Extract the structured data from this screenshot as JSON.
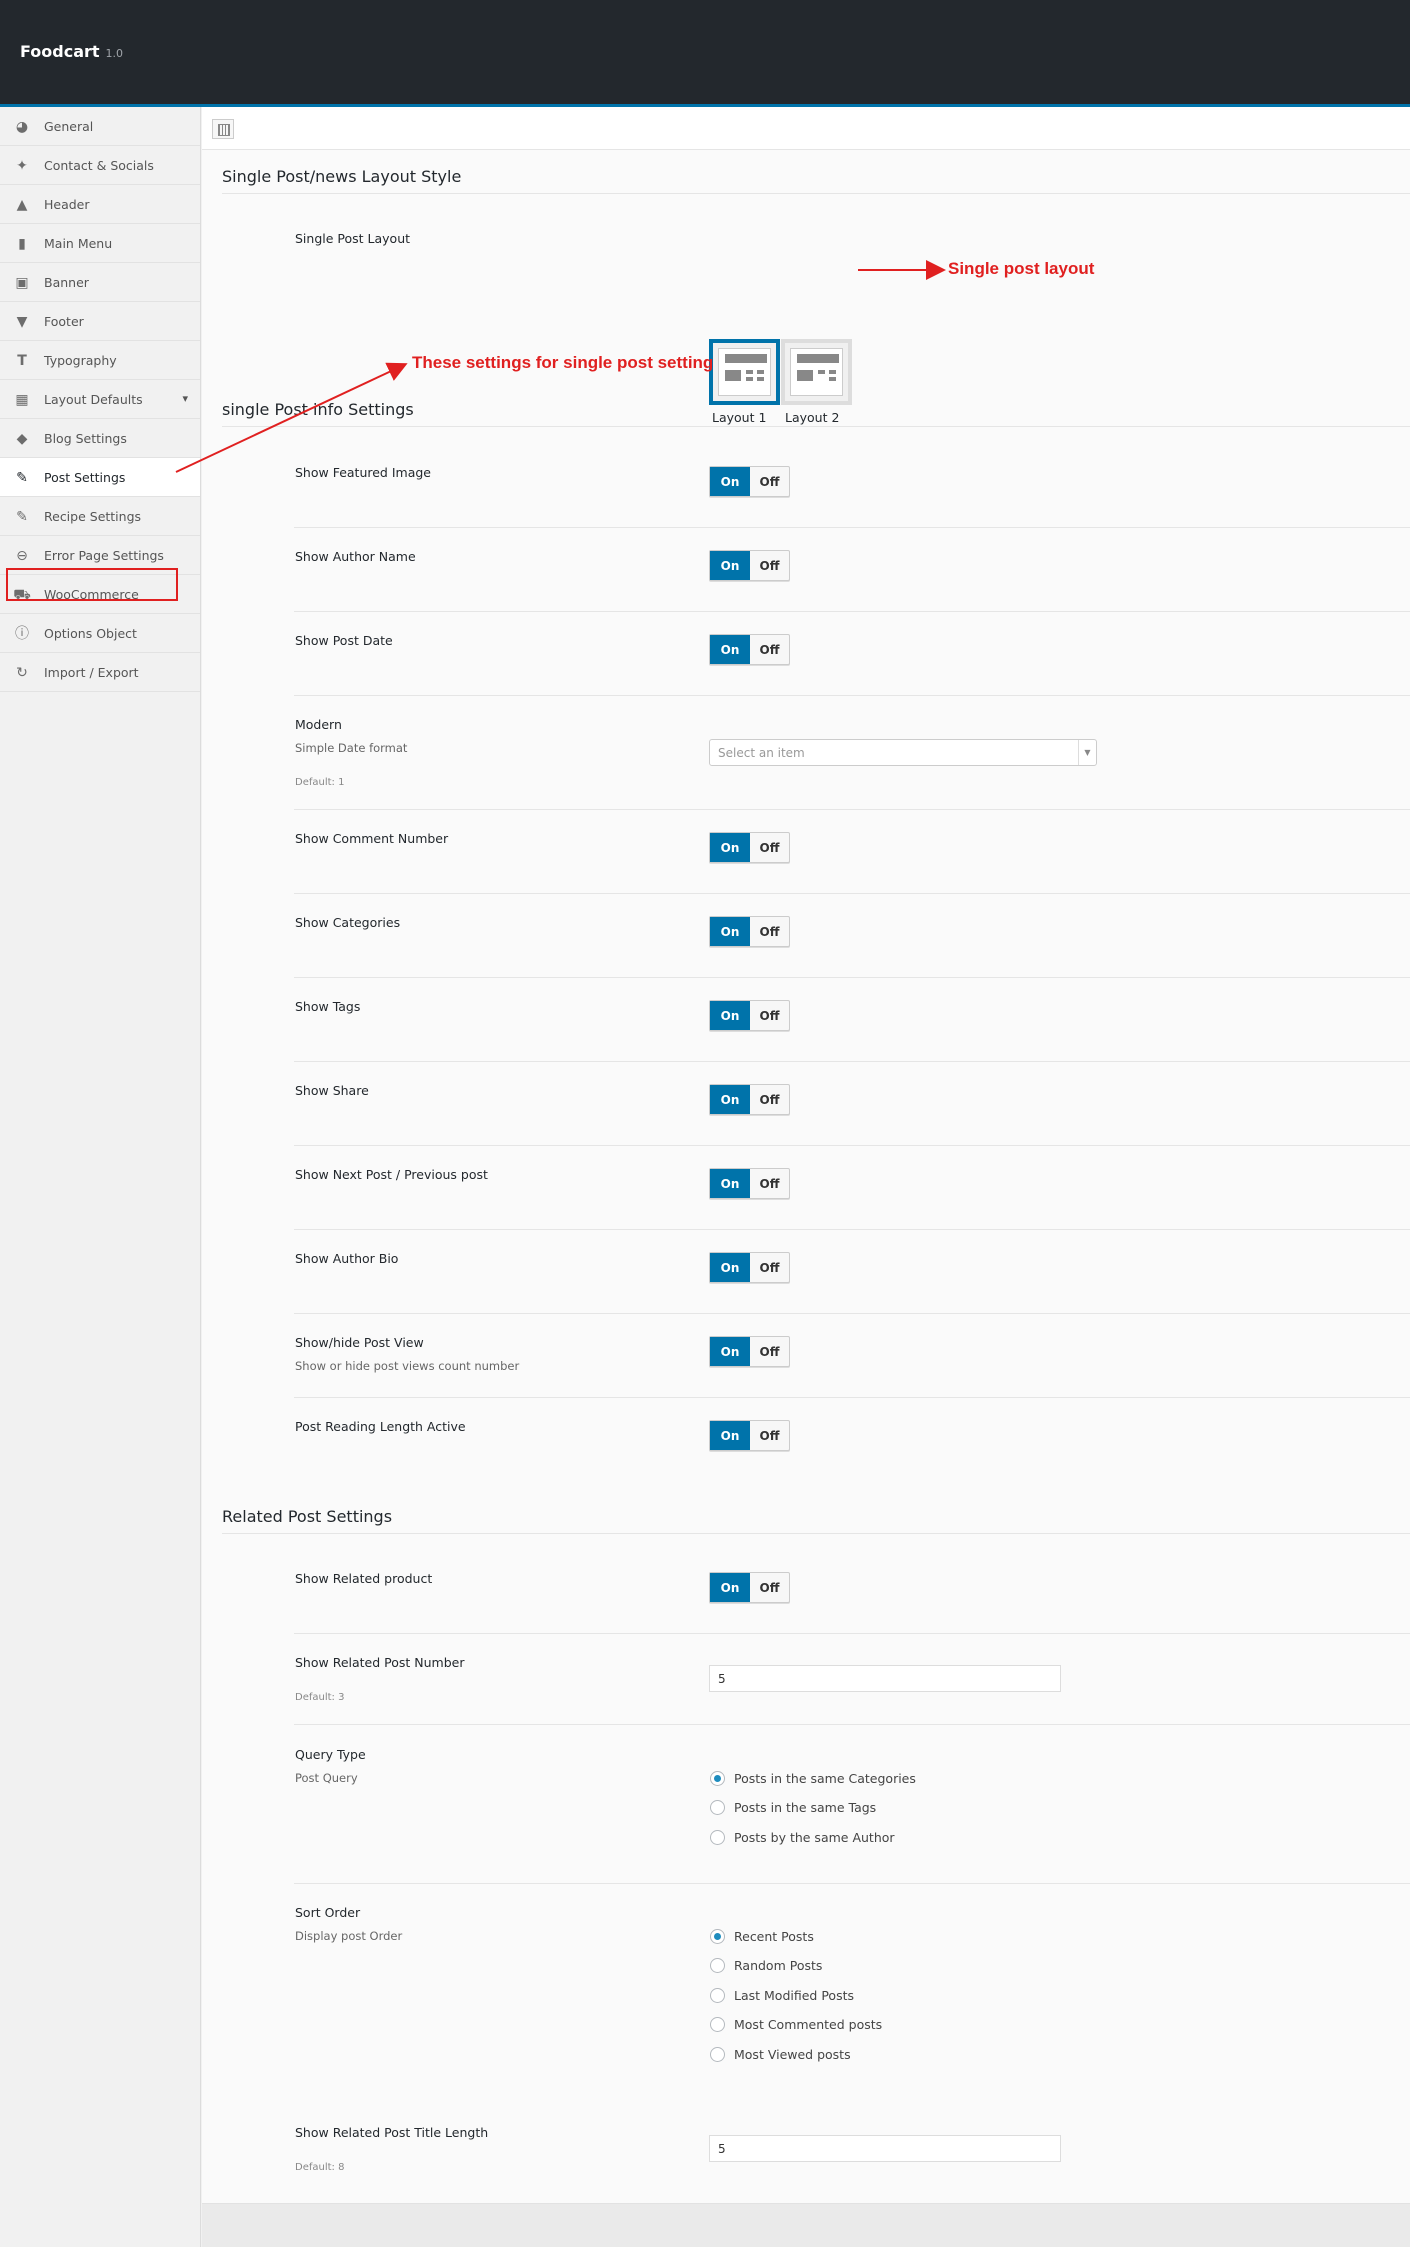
{
  "app": {
    "title": "Foodcart",
    "version": "1.0"
  },
  "sidebar": {
    "items": [
      {
        "label": "General",
        "icon": "dashboard-icon"
      },
      {
        "label": "Contact & Socials",
        "icon": "twitter-icon"
      },
      {
        "label": "Header",
        "icon": "triangle-up-icon"
      },
      {
        "label": "Main Menu",
        "icon": "book-icon"
      },
      {
        "label": "Banner",
        "icon": "image-icon"
      },
      {
        "label": "Footer",
        "icon": "triangle-down-icon"
      },
      {
        "label": "Typography",
        "icon": "text-icon"
      },
      {
        "label": "Layout Defaults",
        "icon": "grid-icon",
        "expandable": true
      },
      {
        "label": "Blog Settings",
        "icon": "tags-icon"
      },
      {
        "label": "Post Settings",
        "icon": "edit-icon",
        "active": true
      },
      {
        "label": "Recipe Settings",
        "icon": "edit-icon"
      },
      {
        "label": "Error Page Settings",
        "icon": "minus-circle-icon"
      },
      {
        "label": "WooCommerce",
        "icon": "cart-icon"
      },
      {
        "label": "Options Object",
        "icon": "info-icon"
      },
      {
        "label": "Import / Export",
        "icon": "refresh-icon"
      }
    ]
  },
  "sections": {
    "layout": {
      "title": "Single Post/news Layout Style"
    },
    "info": {
      "title": "single Post info Settings"
    },
    "related": {
      "title": "Related Post Settings"
    }
  },
  "layout_field": {
    "label": "Single Post Layout",
    "options": [
      {
        "label": "Layout 1",
        "selected": true
      },
      {
        "label": "Layout 2",
        "selected": false
      }
    ]
  },
  "toggle_text": {
    "on": "On",
    "off": "Off"
  },
  "info_fields": {
    "featured_image": {
      "label": "Show Featured Image",
      "value": "On"
    },
    "author_name": {
      "label": "Show Author Name",
      "value": "On"
    },
    "post_date": {
      "label": "Show Post Date",
      "value": "On"
    },
    "modern": {
      "label": "Modern",
      "sub": "Simple Date format",
      "default": "Default: 1",
      "placeholder": "Select an item"
    },
    "comment_number": {
      "label": "Show Comment Number",
      "value": "On"
    },
    "categories": {
      "label": "Show Categories",
      "value": "On"
    },
    "tags": {
      "label": "Show Tags",
      "value": "On"
    },
    "share": {
      "label": "Show Share",
      "value": "On"
    },
    "next_prev": {
      "label": "Show Next Post / Previous post",
      "value": "On"
    },
    "author_bio": {
      "label": "Show Author Bio",
      "value": "On"
    },
    "post_view": {
      "label": "Show/hide Post View",
      "sub": "Show or hide post views count number",
      "value": "On"
    },
    "reading_length": {
      "label": "Post Reading Length Active",
      "value": "On"
    }
  },
  "related_fields": {
    "related_product": {
      "label": "Show Related product",
      "value": "On"
    },
    "post_number": {
      "label": "Show Related Post Number",
      "value": "5",
      "default": "Default: 3"
    },
    "query_type": {
      "label": "Query Type",
      "sub": "Post Query",
      "options": [
        "Posts in the same Categories",
        "Posts in the same Tags",
        "Posts by the same Author"
      ],
      "selected": "Posts in the same Categories"
    },
    "sort_order": {
      "label": "Sort Order",
      "sub": "Display post Order",
      "options": [
        "Recent Posts",
        "Random Posts",
        "Last Modified Posts",
        "Most Commented posts",
        "Most Viewed posts"
      ],
      "selected": "Recent Posts"
    },
    "title_length": {
      "label": "Show Related Post Title Length",
      "value": "5",
      "default": "Default: 8"
    }
  },
  "annotations": {
    "sidebar_note": "These settings for single post setting",
    "layout_note": "Single post layout",
    "color": "#e02020"
  },
  "colors": {
    "accent": "#0073aa",
    "topbar": "#23282d"
  }
}
